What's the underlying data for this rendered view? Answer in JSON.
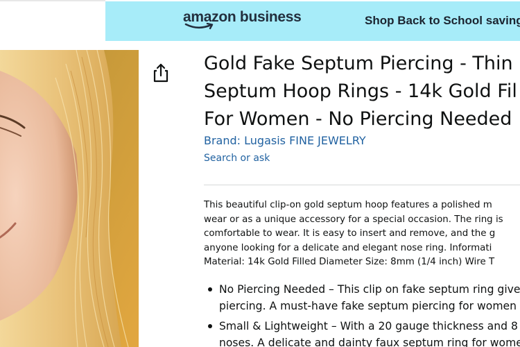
{
  "banner": {
    "logo_text": "amazon business",
    "promo_text": "Shop Back to School savings"
  },
  "share": {
    "icon": "share-icon"
  },
  "product": {
    "title_lines": [
      "Gold Fake Septum Piercing - Thin",
      "Septum Hoop Rings - 14k Gold Fil",
      "For Women - No Piercing Needed"
    ],
    "brand_label": "Brand: Lugasis FINE JEWELRY",
    "search_label": "Search or ask",
    "description_lines": [
      "This beautiful clip-on gold septum hoop features a polished m",
      "wear or as a unique accessory for a special occasion. The ring is",
      "comfortable to wear. It is easy to insert and remove, and the g",
      "anyone looking for a delicate and elegant nose ring. Informati",
      "Material: 14k Gold Filled Diameter Size: 8mm (1/4 inch) Wire T"
    ],
    "bullets": [
      {
        "lines": [
          "No Piercing Needed – This clip on fake septum ring give",
          "piercing. A must-have fake septum piercing for women"
        ]
      },
      {
        "lines": [
          "Small & Lightweight – With a 20 gauge thickness and 8",
          "noses. A delicate and dainty faux septum ring for wome"
        ]
      }
    ]
  },
  "colors": {
    "banner_bg": "#a7ecf9",
    "link": "#2162a1",
    "text": "#0f1111"
  }
}
